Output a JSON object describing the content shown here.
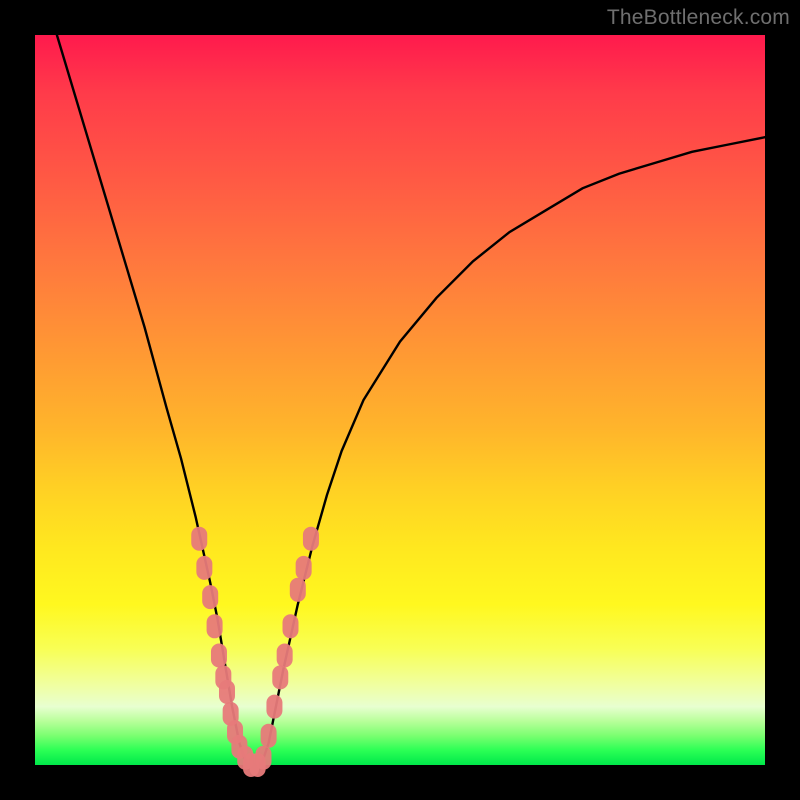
{
  "watermark": "TheBottleneck.com",
  "chart_data": {
    "type": "line",
    "title": "",
    "xlabel": "",
    "ylabel": "",
    "xlim": [
      0,
      100
    ],
    "ylim": [
      0,
      100
    ],
    "grid": false,
    "legend": false,
    "series": [
      {
        "name": "bottleneck-curve",
        "color": "#000000",
        "x": [
          3,
          6,
          9,
          12,
          15,
          18,
          20,
          22,
          24,
          25,
          26,
          27,
          28,
          29,
          30,
          31,
          32,
          33,
          34,
          36,
          38,
          40,
          42,
          45,
          50,
          55,
          60,
          65,
          70,
          75,
          80,
          85,
          90,
          95,
          100
        ],
        "y": [
          100,
          90,
          80,
          70,
          60,
          49,
          42,
          34,
          25,
          20,
          14,
          8,
          3,
          0,
          0,
          0,
          3,
          8,
          13,
          22,
          30,
          37,
          43,
          50,
          58,
          64,
          69,
          73,
          76,
          79,
          81,
          82.5,
          84,
          85,
          86
        ]
      }
    ],
    "scatter_overlay": {
      "name": "highlighted-range-dots",
      "color": "#e77a7a",
      "radius_px": 10,
      "points": [
        {
          "x": 22.5,
          "y": 31
        },
        {
          "x": 23.2,
          "y": 27
        },
        {
          "x": 24.0,
          "y": 23
        },
        {
          "x": 24.6,
          "y": 19
        },
        {
          "x": 25.2,
          "y": 15
        },
        {
          "x": 25.8,
          "y": 12
        },
        {
          "x": 26.3,
          "y": 10
        },
        {
          "x": 26.8,
          "y": 7
        },
        {
          "x": 27.4,
          "y": 4.5
        },
        {
          "x": 28.0,
          "y": 2.5
        },
        {
          "x": 28.8,
          "y": 1
        },
        {
          "x": 29.6,
          "y": 0
        },
        {
          "x": 30.5,
          "y": 0
        },
        {
          "x": 31.3,
          "y": 1
        },
        {
          "x": 32.0,
          "y": 4
        },
        {
          "x": 32.8,
          "y": 8
        },
        {
          "x": 33.6,
          "y": 12
        },
        {
          "x": 34.2,
          "y": 15
        },
        {
          "x": 35.0,
          "y": 19
        },
        {
          "x": 36.0,
          "y": 24
        },
        {
          "x": 36.8,
          "y": 27
        },
        {
          "x": 37.8,
          "y": 31
        }
      ]
    },
    "background_gradient": {
      "top": "#ff1a4d",
      "mid_upper": "#ff9a33",
      "mid": "#ffe71f",
      "mid_lower": "#f0ffa0",
      "bottom": "#00e84a"
    }
  }
}
